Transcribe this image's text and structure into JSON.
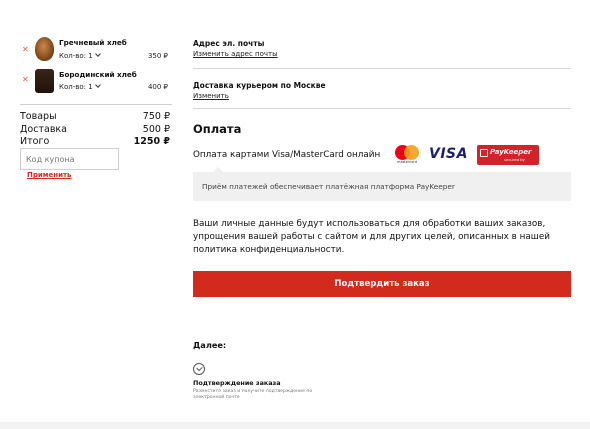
{
  "cart": {
    "items": [
      {
        "name": "Гречневый хлеб",
        "qty": "Кол-во: 1",
        "price": "350 ₽"
      },
      {
        "name": "Бородинский хлеб",
        "qty": "Кол-во: 1",
        "price": "400 ₽"
      }
    ],
    "totals": [
      {
        "label": "Товары",
        "value": "750 ₽"
      },
      {
        "label": "Доставка",
        "value": "500 ₽"
      },
      {
        "label": "Итого",
        "value": "1250 ₽"
      }
    ],
    "coupon_placeholder": "Код купона",
    "apply_label": "Применить"
  },
  "email": {
    "title": "Адрес эл. почты",
    "link": "Изменить адрес почты"
  },
  "delivery": {
    "title": "Доставка курьером по Москве",
    "link": "Изменить"
  },
  "payment": {
    "heading": "Оплата",
    "method": "Оплата картами Visa/MasterCard онлайн",
    "logos": {
      "mastercard_text": "mastercard",
      "visa": "VISA",
      "paykeeper_name": "PayKeeper",
      "paykeeper_sub": "secured by"
    },
    "info": "Приём платежей обеспечивает платёжная платформа PayKeeper"
  },
  "privacy_text": "Ваши личные данные будут использоваться для обработки ваших заказов, упрощения вашей работы с сайтом и для других целей, описанных в нашей политика конфиденциальности.",
  "confirm_button": "Подтвердить заказ",
  "next": {
    "title": "Далее:",
    "step_title": "Подтверждение заказа",
    "step_desc": "Разместите заказ и получите подтверждение по электронной почте"
  },
  "colors": {
    "accent": "#d32a1e",
    "info_bg": "#f0f0f0"
  }
}
